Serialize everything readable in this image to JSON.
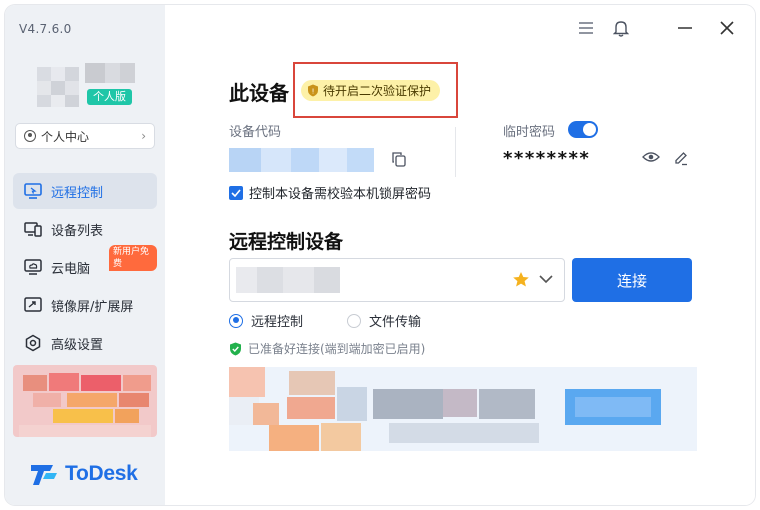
{
  "app": {
    "version": "V4.7.6.0",
    "brand": "ToDesk",
    "brand_color": "#1f6fe5"
  },
  "user": {
    "tier_badge": "个人版",
    "profile_label": "个人中心"
  },
  "sidebar": {
    "items": [
      {
        "label": "远程控制",
        "icon": "monitor-remote-icon",
        "active": true
      },
      {
        "label": "设备列表",
        "icon": "devices-icon",
        "active": false
      },
      {
        "label": "云电脑",
        "icon": "cloud-pc-icon",
        "active": false,
        "badge": "新用户免费"
      },
      {
        "label": "镜像屏/扩展屏",
        "icon": "mirror-screen-icon",
        "active": false
      },
      {
        "label": "高级设置",
        "icon": "settings-gear-icon",
        "active": false
      }
    ]
  },
  "window_controls": {
    "menu_icon": "menu-icon",
    "bell_icon": "bell-icon",
    "minimize_icon": "minimize-icon",
    "close_icon": "close-icon"
  },
  "this_device": {
    "title": "此设备",
    "status_pill": "待开启二次验证保护",
    "device_code_label": "设备代码",
    "temp_password_label": "临时密码",
    "temp_password_enabled": true,
    "temp_password": "********",
    "lock_password_checkbox": "控制本设备需校验本机锁屏密码",
    "lock_password_checked": true
  },
  "remote_control": {
    "title": "远程控制设备",
    "connect_button": "连接",
    "modes": [
      {
        "label": "远程控制",
        "selected": true
      },
      {
        "label": "文件传输",
        "selected": false
      }
    ],
    "ready_status": "已准备好连接(端到端加密已启用)"
  }
}
